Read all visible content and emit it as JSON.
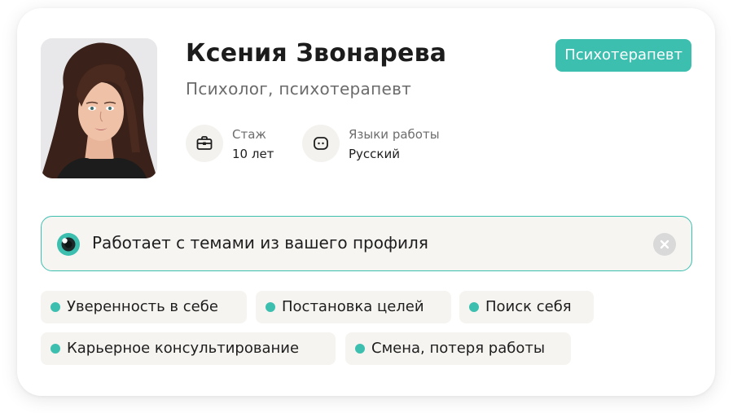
{
  "specialist": {
    "name": "Ксения Звонарева",
    "role": "Психолог,  психотерапевт",
    "badge": "Психотерапевт",
    "photo_alt": "avatar"
  },
  "stats": {
    "experience": {
      "label": "Стаж",
      "value": "10 лет",
      "icon": "briefcase-icon"
    },
    "languages": {
      "label": "Языки работы",
      "value": "Русский",
      "icon": "chat-bubble-icon"
    }
  },
  "match_notice": {
    "text": "Работает с темами из вашего профиля",
    "icon": "eye-icon",
    "close_icon": "close-icon"
  },
  "topics": [
    "Уверенность в себе",
    "Постановка целей",
    "Поиск себя",
    "Карьерное консультирование",
    "Смена, потеря работы"
  ],
  "colors": {
    "accent": "#3dbfb0",
    "tag_bg": "#f6f4f0",
    "text_primary": "#1e1e1e",
    "text_secondary": "#6b6b6b"
  }
}
